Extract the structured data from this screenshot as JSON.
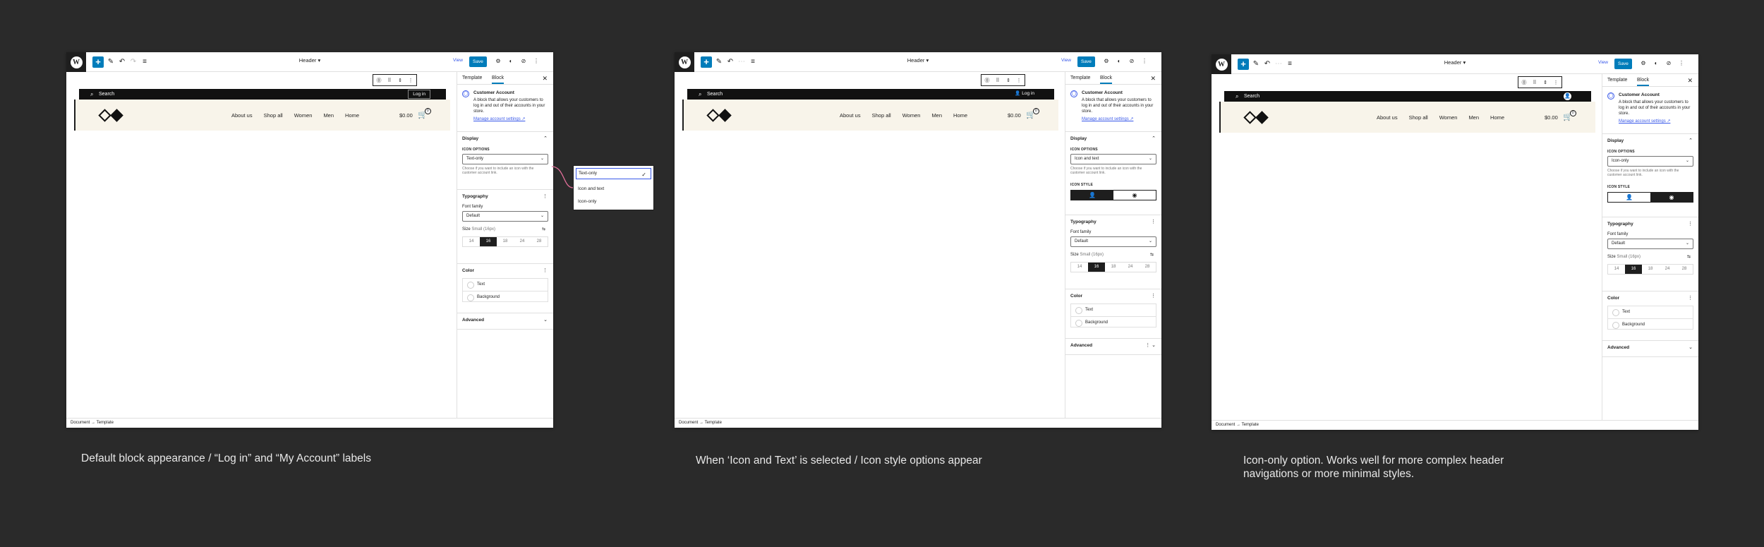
{
  "panels": [
    {
      "topbar": {
        "logo": "W",
        "title": "Header",
        "view": "View",
        "save": "Save"
      },
      "search_label": "Search",
      "login_label": "Log in",
      "nav": [
        "About us",
        "Shop all",
        "Women",
        "Men",
        "Home"
      ],
      "price": "$0.00",
      "cart_count": "0",
      "footer": "Document  →  Template",
      "sidebar": {
        "tab_template": "Template",
        "tab_block": "Block",
        "block_title": "Customer Account",
        "block_desc": "A block that allows your customers to log in and out of their accounts in your store.",
        "manage_link": "Manage account settings ↗",
        "display": "Display",
        "icon_options_label": "ICON OPTIONS",
        "icon_options_value": "Text-only",
        "help": "Choose if you want to include an icon with the customer account link.",
        "typography": "Typography",
        "font_family_label": "Font family",
        "font_family_value": "Default",
        "size_label": "Size",
        "size_value": "Small (16px)",
        "sizes": [
          "14",
          "16",
          "18",
          "24",
          "28"
        ],
        "color": "Color",
        "color_text": "Text",
        "color_bg": "Background",
        "advanced": "Advanced"
      },
      "dropdown": {
        "options": [
          "Text-only",
          "Icon and text",
          "Icon-only"
        ],
        "selected": "Text-only"
      }
    },
    {
      "topbar": {
        "logo": "W",
        "title": "Header",
        "view": "View",
        "save": "Save"
      },
      "search_label": "Search",
      "login_label": "Log in",
      "nav": [
        "About us",
        "Shop all",
        "Women",
        "Men",
        "Home"
      ],
      "price": "$0.00",
      "cart_count": "0",
      "footer": "Document  →  Template",
      "sidebar": {
        "tab_template": "Template",
        "tab_block": "Block",
        "block_title": "Customer Account",
        "block_desc": "A block that allows your customers to log in and out of their accounts in your store.",
        "manage_link": "Manage account settings ↗",
        "display": "Display",
        "icon_options_label": "ICON OPTIONS",
        "icon_options_value": "Icon and text",
        "help": "Choose if you want to include an icon with the customer account link.",
        "icon_style_label": "ICON STYLE",
        "typography": "Typography",
        "font_family_label": "Font family",
        "font_family_value": "Default",
        "size_label": "Size",
        "size_value": "Small (16px)",
        "sizes": [
          "14",
          "16",
          "18",
          "24",
          "28"
        ],
        "color": "Color",
        "color_text": "Text",
        "color_bg": "Background",
        "advanced": "Advanced"
      }
    },
    {
      "topbar": {
        "logo": "W",
        "title": "Header",
        "view": "View",
        "save": "Save"
      },
      "search_label": "Search",
      "nav": [
        "About us",
        "Shop all",
        "Women",
        "Men",
        "Home"
      ],
      "price": "$0.00",
      "cart_count": "0",
      "footer": "Document  →  Template",
      "sidebar": {
        "tab_template": "Template",
        "tab_block": "Block",
        "block_title": "Customer Account",
        "block_desc": "A block that allows your customers to log in and out of their accounts in your store.",
        "manage_link": "Manage account settings ↗",
        "display": "Display",
        "icon_options_label": "ICON OPTIONS",
        "icon_options_value": "Icon-only",
        "help": "Choose if you want to include an icon with the customer account link.",
        "icon_style_label": "ICON STYLE",
        "typography": "Typography",
        "font_family_label": "Font family",
        "font_family_value": "Default",
        "size_label": "Size",
        "size_value": "Small (16px)",
        "sizes": [
          "14",
          "16",
          "18",
          "24",
          "28"
        ],
        "color": "Color",
        "color_text": "Text",
        "color_bg": "Background",
        "advanced": "Advanced"
      }
    }
  ],
  "captions": [
    "Default block appearance / “Log in” and “My Account” labels",
    "When ‘Icon and Text’ is selected / Icon style options appear",
    "Icon-only option. Works well for more complex header navigations or more minimal styles."
  ],
  "colors": {
    "background": "#2a2a2a",
    "accent": "#007cba",
    "wp_blue": "#3858e9",
    "header_band": "#f8f4ea"
  }
}
